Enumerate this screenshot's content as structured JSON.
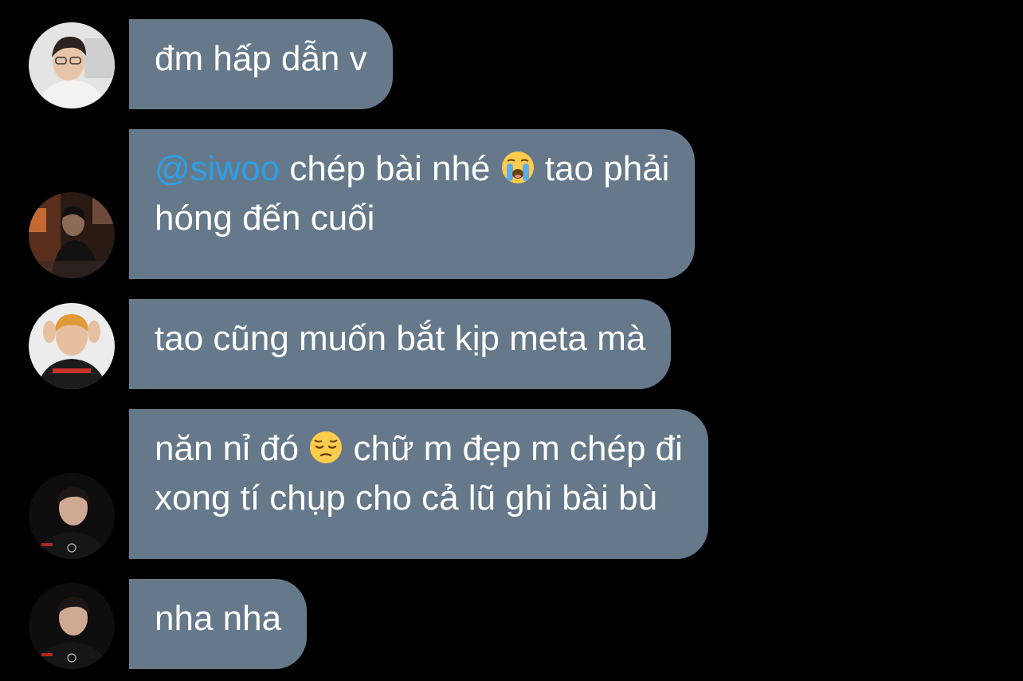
{
  "messages": [
    {
      "avatar": "avatar-white-hoodie-boy",
      "lines": [
        "đm hấp dẫn v"
      ]
    },
    {
      "avatar": "avatar-dark-silhouette",
      "mention": "@siwoo",
      "line1_a": " chép bài nhé ",
      "emoji1": "loudly-crying-face",
      "line1_b": "  tao phải",
      "line2": "hóng đến cuối"
    },
    {
      "avatar": "avatar-griffin-player",
      "lines": [
        "tao cũng muốn bắt kịp meta mà"
      ]
    },
    {
      "avatar": "avatar-mercedes-jersey",
      "line1_a": "năn nỉ đó ",
      "emoji1": "pensive-face",
      "line1_b": "  chữ m đẹp m chép đi",
      "line2": "xong tí chụp cho cả lũ ghi bài bù"
    },
    {
      "avatar": "avatar-mercedes-jersey",
      "lines": [
        "nha nha"
      ]
    }
  ],
  "colors": {
    "background": "#000000",
    "bubble": "#66798a",
    "text": "#ffffff",
    "mention": "#2aa0e8"
  }
}
